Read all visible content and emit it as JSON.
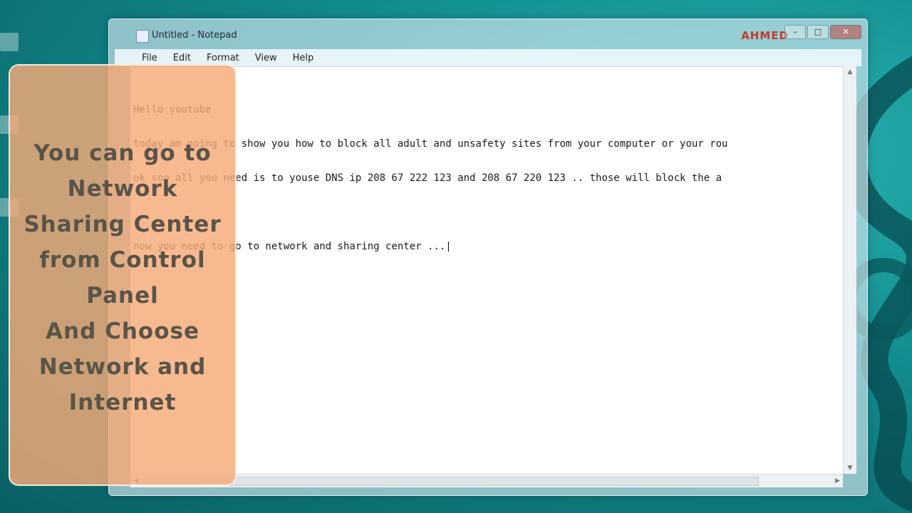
{
  "window": {
    "title": "Untitled - Notepad",
    "brand_watermark": "AHMED"
  },
  "window_buttons": {
    "minimize": "–",
    "maximize": "□",
    "close": "✕"
  },
  "menu": {
    "items": [
      "File",
      "Edit",
      "Format",
      "View",
      "Help"
    ]
  },
  "editor": {
    "lines": [
      "Hello youtube",
      "today am going to show you how to block all adult and unsafety sites from your computer or your rou",
      "ok soo all you need is to youse DNS ip 208 67 222 123 and 208 67 220 123 .. those will block the a",
      "",
      "now you need to go to network and sharing center ...|"
    ]
  },
  "callout": {
    "lines": [
      "You can go to",
      "Network",
      "Sharing Center",
      "from Control",
      "Panel",
      "And Choose",
      "Network and",
      "Internet"
    ]
  },
  "colors": {
    "desktop": "#128c8f",
    "callout_fill": "#f5aa78",
    "callout_text": "#5a5448",
    "brand": "#c23b2c"
  }
}
